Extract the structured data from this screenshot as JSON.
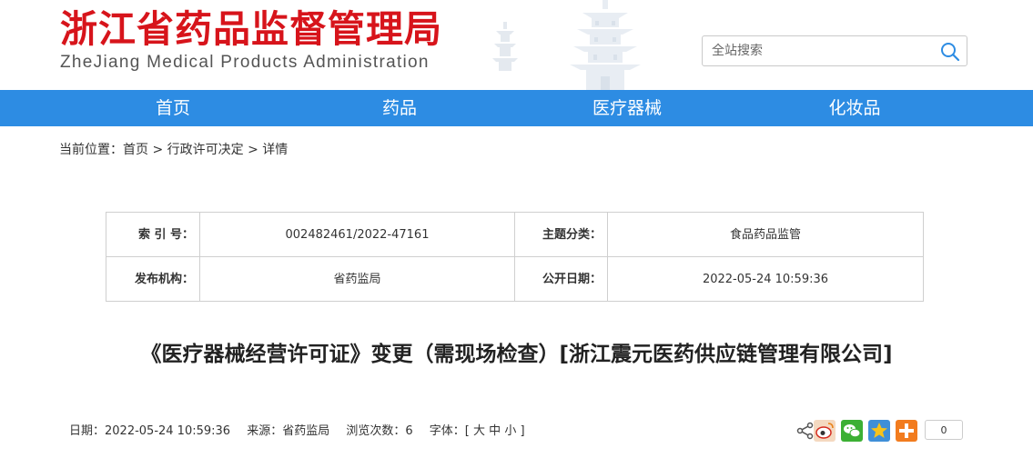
{
  "header": {
    "title_cn": "浙江省药品监督管理局",
    "title_en": "ZheJiang Medical Products Administration"
  },
  "search": {
    "placeholder": "全站搜索"
  },
  "nav": {
    "items": [
      {
        "label": "首页"
      },
      {
        "label": "药品"
      },
      {
        "label": "医疗器械"
      },
      {
        "label": "化妆品"
      }
    ]
  },
  "breadcrumb": {
    "prefix": "当前位置：",
    "items": [
      "首页",
      "行政许可决定",
      "详情"
    ],
    "separator": ">"
  },
  "meta": {
    "index_label": "索 引 号：",
    "index_value": "002482461/2022-47161",
    "topic_label": "主题分类：",
    "topic_value": "食品药品监管",
    "publisher_label": "发布机构：",
    "publisher_value": "省药监局",
    "date_label": "公开日期：",
    "date_value": "2022-05-24 10:59:36"
  },
  "article": {
    "title": "《医疗器械经营许可证》变更（需现场检查）[浙江震元医药供应链管理有限公司]"
  },
  "info": {
    "date": "日期：2022-05-24 10:59:36",
    "source": "来源：省药监局",
    "views": "浏览次数：6",
    "font_label": "字体：[",
    "font_large": "大",
    "font_medium": "中",
    "font_small": "小",
    "font_close": "]"
  },
  "share": {
    "count": "0"
  },
  "colors": {
    "brand_red": "#d7141b",
    "nav_blue": "#2d8ce3"
  }
}
